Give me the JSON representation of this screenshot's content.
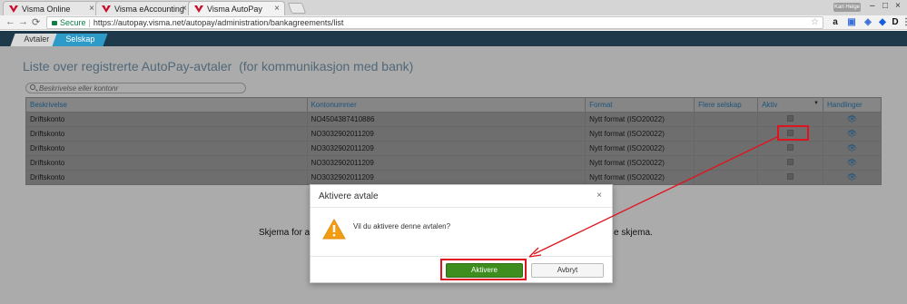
{
  "browser": {
    "tabs": [
      {
        "label": "Visma Online",
        "active": false
      },
      {
        "label": "Visma eAccounting",
        "active": false
      },
      {
        "label": "Visma AutoPay",
        "active": true
      }
    ],
    "user": "Kari Helge",
    "address": {
      "secure_label": "Secure",
      "url": "https://autopay.visma.net/autopay/administration/bankagreements/list"
    },
    "extensions": [
      "amazon-icon",
      "calendar-icon",
      "shield-icon",
      "bitwarden-icon",
      "d-icon",
      "menu-icon"
    ]
  },
  "app": {
    "tabs": [
      {
        "label": "Avtaler"
      },
      {
        "label": "Selskap"
      }
    ]
  },
  "page": {
    "title": "Liste over registrerte AutoPay-avtaler",
    "subtitle": "(for kommunikasjon med bank)",
    "search_placeholder": "Beskrivelse eller kontonr",
    "columns": [
      "Beskrivelse",
      "Kontonummer",
      "Format",
      "Flere selskap",
      "Aktiv",
      "Handlinger"
    ],
    "rows": [
      {
        "beskrivelse": "Driftskonto",
        "kontonummer": "NO4504387410886",
        "format": "Nytt format (ISO20022)",
        "flere_selskap": "",
        "aktiv": false
      },
      {
        "beskrivelse": "Driftskonto",
        "kontonummer": "NO3032902011209",
        "format": "Nytt format (ISO20022)",
        "flere_selskap": "",
        "aktiv": false
      },
      {
        "beskrivelse": "Driftskonto",
        "kontonummer": "NO3032902011209",
        "format": "Nytt format (ISO20022)",
        "flere_selskap": "",
        "aktiv": false
      },
      {
        "beskrivelse": "Driftskonto",
        "kontonummer": "NO3032902011209",
        "format": "Nytt format (ISO20022)",
        "flere_selskap": "",
        "aktiv": false
      },
      {
        "beskrivelse": "Driftskonto",
        "kontonummer": "NO3032902011209",
        "format": "Nytt format (ISO20022)",
        "flere_selskap": "",
        "aktiv": false
      }
    ],
    "background_text_left": "Skjema for avt",
    "background_text_right": "e skjema."
  },
  "modal": {
    "title": "Aktivere avtale",
    "message": "Vil du aktivere denne avtalen?",
    "confirm_label": "Aktivere",
    "cancel_label": "Avbryt"
  },
  "colors": {
    "header_bg": "#1e3a4a",
    "accent": "#2e9ac8",
    "primary_button": "#3d8e1f",
    "highlight": "#e0141e",
    "warning": "#f39c12"
  }
}
